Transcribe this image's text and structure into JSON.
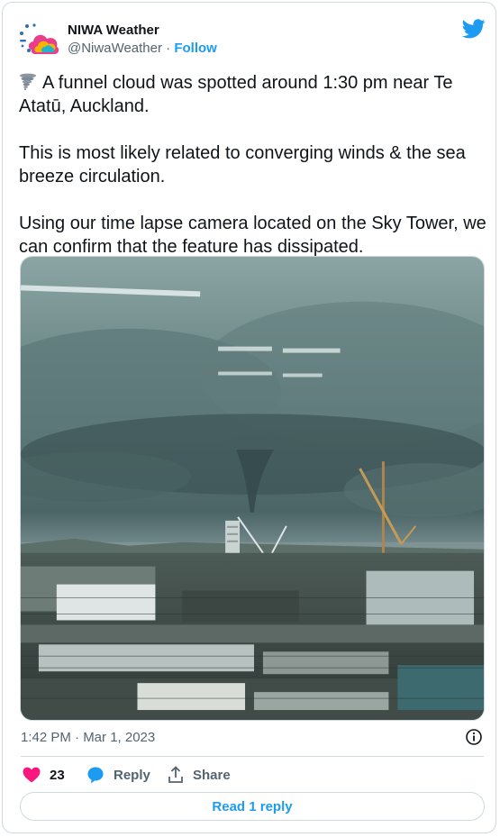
{
  "tweet": {
    "author_name": "NIWA Weather",
    "handle": "@NiwaWeather",
    "separator": "·",
    "follow_label": "Follow",
    "paragraphs": [
      "A funnel cloud was spotted around 1:30 pm near Te Atatū, Auckland.",
      "This is most likely related to converging winds & the sea breeze circulation.",
      "Using our time lapse camera located on the Sky Tower, we can confirm that the feature has dissipated."
    ],
    "timestamp": "1:42 PM · Mar 1, 2023"
  },
  "actions": {
    "like_count": "23",
    "reply_label": "Reply",
    "share_label": "Share",
    "read_replies_label": "Read 1 reply"
  },
  "icons": {
    "avatar": "niwa-logo-icon",
    "twitter": "twitter-bird-icon",
    "tornado": "tornado-emoji-icon",
    "info": "info-icon",
    "heart": "heart-icon",
    "reply": "speech-bubble-icon",
    "share": "share-upload-icon"
  },
  "colors": {
    "accent": "#1d9bf0",
    "like": "#f91880",
    "text": "#0f1419",
    "muted": "#536471",
    "border": "#cfd9de"
  }
}
